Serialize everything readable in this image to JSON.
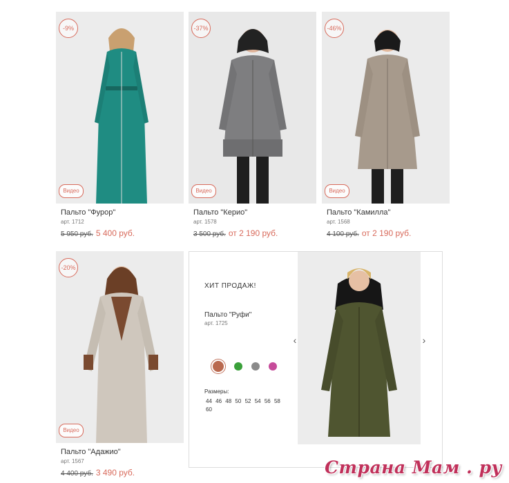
{
  "products": [
    {
      "badge": "-9%",
      "video_label": "Видео",
      "name": "Пальто \"Фурор\"",
      "art": "арт. 1712",
      "old_price": "5 950 руб.",
      "new_price": "5 400 руб.",
      "coat_color": "#1f8c82"
    },
    {
      "badge": "-37%",
      "video_label": "Видео",
      "name": "Пальто \"Керио\"",
      "art": "арт. 1578",
      "old_price": "3 500 руб.",
      "new_price": "от 2 190 руб.",
      "coat_color": "#7e7e80"
    },
    {
      "badge": "-46%",
      "video_label": "Видео",
      "name": "Пальто \"Камилла\"",
      "art": "арт. 1568",
      "old_price": "4 100 руб.",
      "new_price": "от 2 190 руб.",
      "coat_color": "#a79a8c"
    },
    {
      "badge": "-20%",
      "video_label": "Видео",
      "name": "Пальто \"Адажио\"",
      "art": "арт. 1567",
      "old_price": "4 400 руб.",
      "new_price": "3 490 руб.",
      "coat_color": "#cfc7bd"
    }
  ],
  "featured": {
    "title": "ХИТ ПРОДАЖ!",
    "name": "Пальто \"Руфи\"",
    "art": "арт. 1725",
    "prev_arrow": "‹",
    "next_arrow": "›",
    "colors": [
      "#b9694f",
      "#3aa03a",
      "#8a8a8a",
      "#c64b9a"
    ],
    "sizes_label": "Размеры:",
    "sizes": [
      "44",
      "46",
      "48",
      "50",
      "52",
      "54",
      "56",
      "58",
      "60"
    ],
    "coat_color": "#4f5530"
  },
  "watermark": "Страна Мам . ру",
  "colors": {
    "accent": "#d86a5b"
  }
}
